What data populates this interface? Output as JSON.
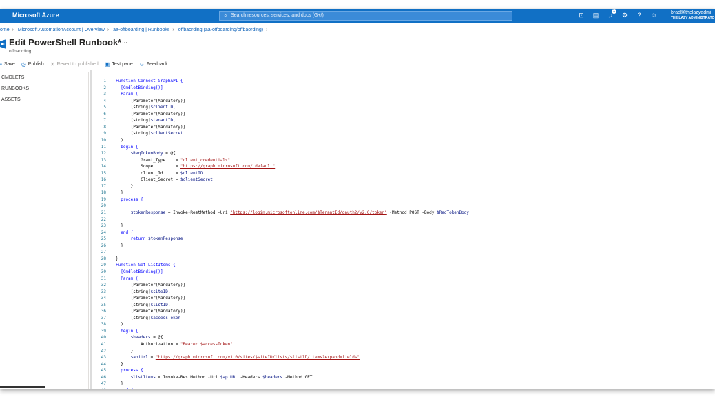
{
  "topbar": {
    "brand": "Microsoft Azure",
    "search_placeholder": "Search resources, services, and docs (G+/)",
    "notification_count": "1",
    "user_name": "brad@thelazyadmi",
    "user_org": "THE LAZY ADMINISTRATO"
  },
  "breadcrumb": [
    "ome",
    "Microsoft.AutomationAccount | Overview",
    "aa-offboarding | Runbooks",
    "offbaording (aa-offboarding/offbaording)"
  ],
  "page": {
    "title": "Edit PowerShell Runbook*",
    "more": "···",
    "subtitle": "offbaording"
  },
  "toolbar": {
    "save": "Save",
    "publish": "Publish",
    "revert": "Revert to published",
    "test": "Test pane",
    "feedback": "Feedback"
  },
  "sidebar": [
    "CMDLETS",
    "RUNBOOKS",
    "ASSETS"
  ],
  "code_lines": [
    [
      {
        "t": "Function Connect-GraphAPI {",
        "c": "kw"
      }
    ],
    [
      {
        "t": "  [CmdletBinding()]",
        "c": "kw"
      }
    ],
    [
      {
        "t": "  Param (",
        "c": "kw"
      }
    ],
    [
      {
        "t": "      [Parameter(Mandatory)]",
        "c": ""
      }
    ],
    [
      {
        "t": "      [string]",
        "c": ""
      },
      {
        "t": "$clientID",
        "c": "var"
      },
      {
        "t": ",",
        "c": ""
      }
    ],
    [
      {
        "t": "      [Parameter(Mandatory)]",
        "c": ""
      }
    ],
    [
      {
        "t": "      [string]",
        "c": ""
      },
      {
        "t": "$tenantID",
        "c": "var"
      },
      {
        "t": ",",
        "c": ""
      }
    ],
    [
      {
        "t": "      [Parameter(Mandatory)]",
        "c": ""
      }
    ],
    [
      {
        "t": "      [string]",
        "c": ""
      },
      {
        "t": "$clientSecret",
        "c": "var"
      }
    ],
    [
      {
        "t": "  )",
        "c": ""
      }
    ],
    [
      {
        "t": "  begin {",
        "c": "kw"
      }
    ],
    [
      {
        "t": "      ",
        "c": ""
      },
      {
        "t": "$ReqTokenBody",
        "c": "var"
      },
      {
        "t": " = @{",
        "c": ""
      }
    ],
    [
      {
        "t": "          Grant_Type    = ",
        "c": ""
      },
      {
        "t": "\"client_credentials\"",
        "c": "str"
      }
    ],
    [
      {
        "t": "          Scope         = ",
        "c": ""
      },
      {
        "t": "\"https://graph.microsoft.com/.default\"",
        "c": "uri"
      }
    ],
    [
      {
        "t": "          client_Id     = ",
        "c": ""
      },
      {
        "t": "$clientID",
        "c": "var"
      }
    ],
    [
      {
        "t": "          Client_Secret = ",
        "c": ""
      },
      {
        "t": "$clientSecret",
        "c": "var"
      }
    ],
    [
      {
        "t": "      }",
        "c": ""
      }
    ],
    [
      {
        "t": "  }",
        "c": ""
      }
    ],
    [
      {
        "t": "  process {",
        "c": "kw"
      }
    ],
    [
      {
        "t": "",
        "c": ""
      }
    ],
    [
      {
        "t": "      ",
        "c": ""
      },
      {
        "t": "$tokenResponse",
        "c": "var"
      },
      {
        "t": " = Invoke-RestMethod -Uri ",
        "c": ""
      },
      {
        "t": "\"https://login.microsoftonline.com/$TenantId/oauth2/v2.0/token\"",
        "c": "uri"
      },
      {
        "t": " -Method POST -Body ",
        "c": ""
      },
      {
        "t": "$ReqTokenBody",
        "c": "var"
      }
    ],
    [
      {
        "t": "",
        "c": ""
      }
    ],
    [
      {
        "t": "  }",
        "c": ""
      }
    ],
    [
      {
        "t": "  end {",
        "c": "kw"
      }
    ],
    [
      {
        "t": "      return ",
        "c": "kw"
      },
      {
        "t": "$tokenResponse",
        "c": "var"
      }
    ],
    [
      {
        "t": "  }",
        "c": ""
      }
    ],
    [
      {
        "t": "",
        "c": ""
      }
    ],
    [
      {
        "t": "}",
        "c": ""
      }
    ],
    [
      {
        "t": "Function Get-ListItems {",
        "c": "kw"
      }
    ],
    [
      {
        "t": "  [CmdletBinding()]",
        "c": "kw"
      }
    ],
    [
      {
        "t": "  Param (",
        "c": "kw"
      }
    ],
    [
      {
        "t": "      [Parameter(Mandatory)]",
        "c": ""
      }
    ],
    [
      {
        "t": "      [string]",
        "c": ""
      },
      {
        "t": "$siteID",
        "c": "var"
      },
      {
        "t": ",",
        "c": ""
      }
    ],
    [
      {
        "t": "      [Parameter(Mandatory)]",
        "c": ""
      }
    ],
    [
      {
        "t": "      [string]",
        "c": ""
      },
      {
        "t": "$listID",
        "c": "var"
      },
      {
        "t": ",",
        "c": ""
      }
    ],
    [
      {
        "t": "      [Parameter(Mandatory)]",
        "c": ""
      }
    ],
    [
      {
        "t": "      [string]",
        "c": ""
      },
      {
        "t": "$accessToken",
        "c": "var"
      }
    ],
    [
      {
        "t": "  )",
        "c": ""
      }
    ],
    [
      {
        "t": "  begin {",
        "c": "kw"
      }
    ],
    [
      {
        "t": "      ",
        "c": ""
      },
      {
        "t": "$headers",
        "c": "var"
      },
      {
        "t": " = @{",
        "c": ""
      }
    ],
    [
      {
        "t": "          Authorization = ",
        "c": ""
      },
      {
        "t": "\"Bearer $accessToken\"",
        "c": "str"
      }
    ],
    [
      {
        "t": "      }",
        "c": ""
      }
    ],
    [
      {
        "t": "      ",
        "c": ""
      },
      {
        "t": "$apiUrl",
        "c": "var"
      },
      {
        "t": " = ",
        "c": ""
      },
      {
        "t": "\"https://graph.microsoft.com/v1.0/sites/$siteID/lists/$listID/items?expand=fields\"",
        "c": "uri"
      }
    ],
    [
      {
        "t": "  }",
        "c": ""
      }
    ],
    [
      {
        "t": "  process {",
        "c": "kw"
      }
    ],
    [
      {
        "t": "      ",
        "c": ""
      },
      {
        "t": "$listItems",
        "c": "var"
      },
      {
        "t": " = Invoke-RestMethod -Uri ",
        "c": ""
      },
      {
        "t": "$apiURL",
        "c": "var"
      },
      {
        "t": " -Headers ",
        "c": ""
      },
      {
        "t": "$headers",
        "c": "var"
      },
      {
        "t": " -Method GET",
        "c": ""
      }
    ],
    [
      {
        "t": "  }",
        "c": ""
      }
    ],
    [
      {
        "t": "  end {",
        "c": "kw"
      }
    ]
  ],
  "colors": {
    "topbar": "#1170c5",
    "link": "#0f62b8",
    "keyword": "#0000ff",
    "variable": "#001080",
    "string": "#a31515",
    "line_number": "#237893"
  }
}
